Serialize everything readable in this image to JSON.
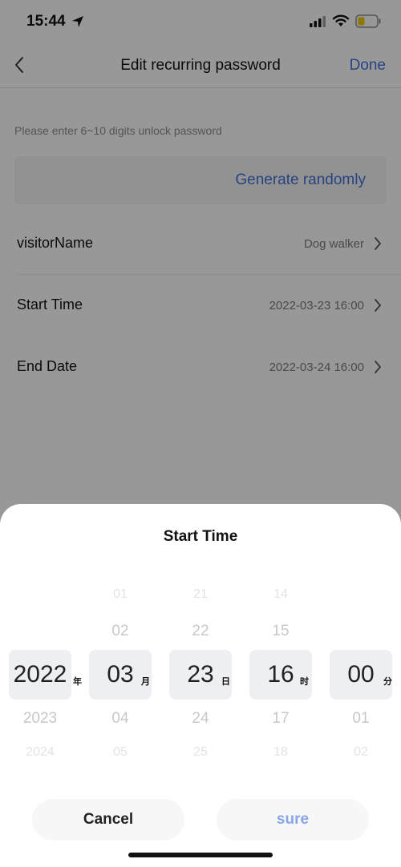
{
  "status_bar": {
    "time": "15:44"
  },
  "nav": {
    "back_icon": "chevron-left-icon",
    "title": "Edit recurring password",
    "done": "Done"
  },
  "form": {
    "hint": "Please enter 6~10 digits unlock password",
    "generate": "Generate randomly",
    "rows": [
      {
        "label": "visitorName",
        "value": "Dog walker"
      },
      {
        "label": "Start Time",
        "value": "2022-03-23 16:00"
      },
      {
        "label": "End Date",
        "value": "2022-03-24 16:00"
      }
    ]
  },
  "sheet": {
    "title": "Start Time",
    "columns": [
      {
        "above_far": "",
        "above": "",
        "selected": "2022",
        "unit": "年",
        "below": "2023",
        "below_far": "2024"
      },
      {
        "above_far": "01",
        "above": "02",
        "selected": "03",
        "unit": "月",
        "below": "04",
        "below_far": "05"
      },
      {
        "above_far": "21",
        "above": "22",
        "selected": "23",
        "unit": "日",
        "below": "24",
        "below_far": "25"
      },
      {
        "above_far": "14",
        "above": "15",
        "selected": "16",
        "unit": "时",
        "below": "17",
        "below_far": "18"
      },
      {
        "above_far": "",
        "above": "",
        "selected": "00",
        "unit": "分",
        "below": "01",
        "below_far": "02"
      }
    ],
    "cancel": "Cancel",
    "sure": "sure"
  },
  "colors": {
    "accent": "#3f6ed0",
    "sure": "#8aa6e6"
  }
}
